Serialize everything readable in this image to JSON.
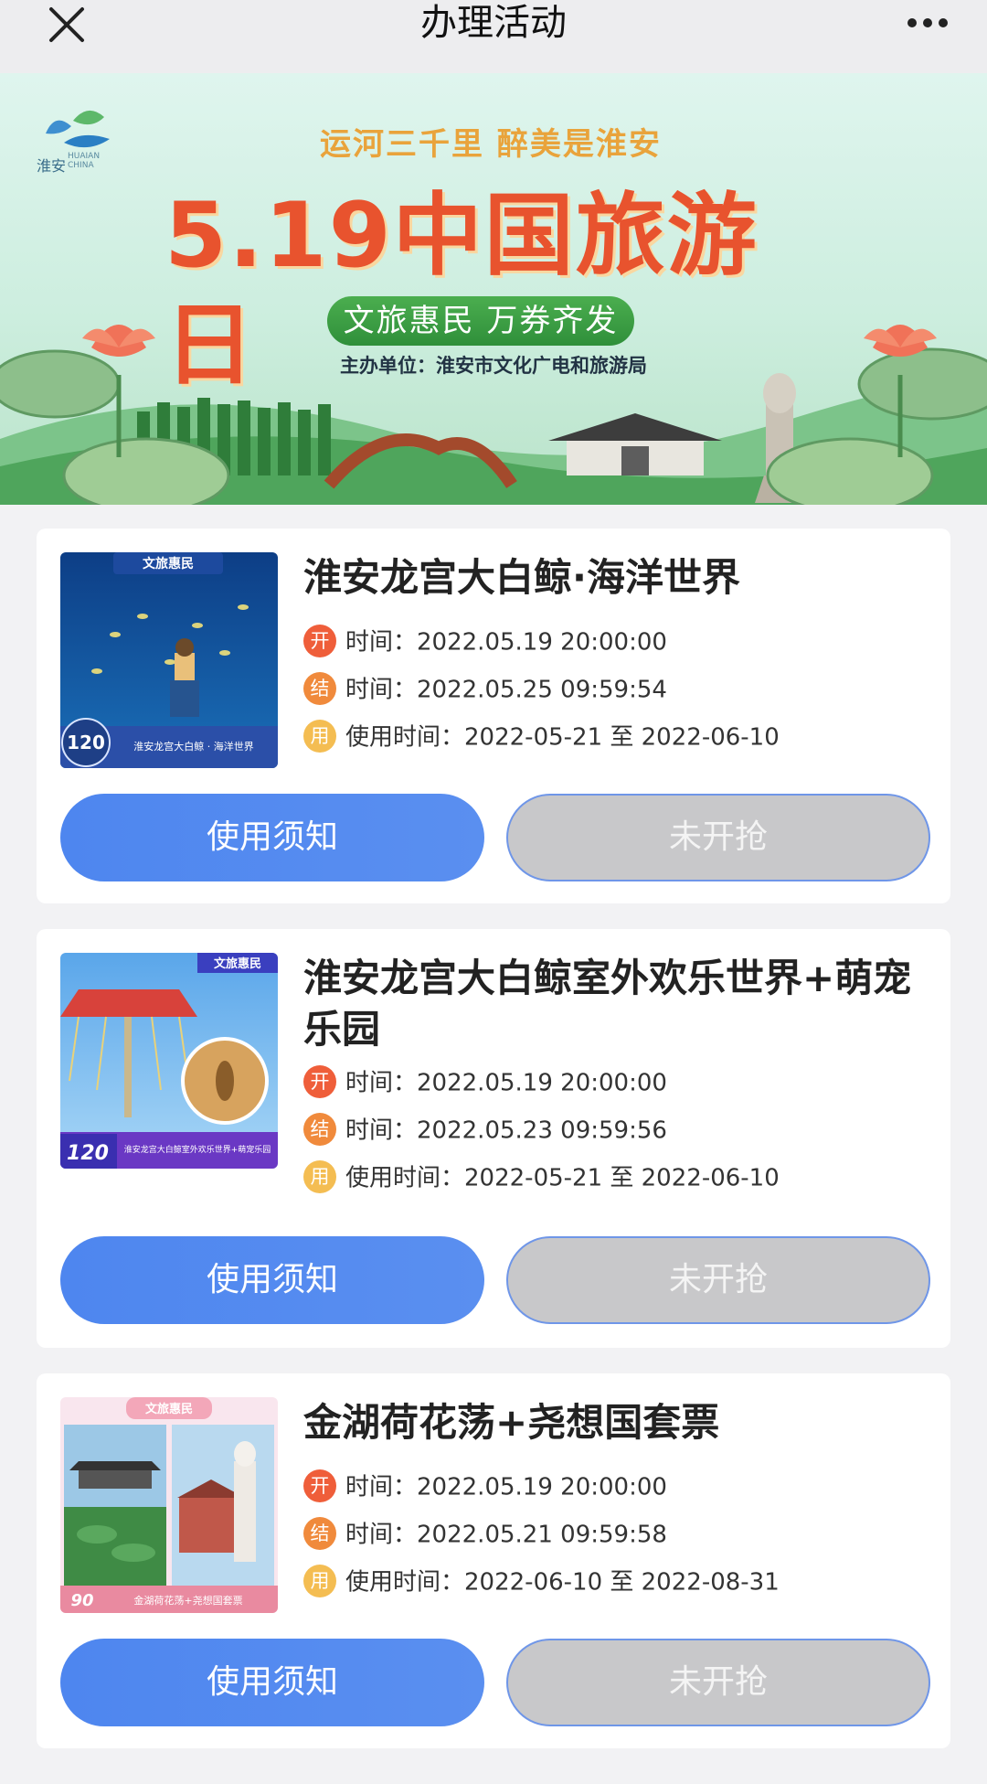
{
  "nav": {
    "title": "办理活动",
    "close_icon": "close-icon",
    "more_icon": "more-icon"
  },
  "banner": {
    "logo_text": "淮安",
    "logo_sub_1": "HUAIAN",
    "logo_sub_2": "CHINA",
    "slogan": "运河三千里 醉美是淮安",
    "headline": "5.19中国旅游日",
    "pill": "文旅惠民 万券齐发",
    "organizer": "主办单位：淮安市文化广电和旅游局"
  },
  "cards": [
    {
      "title": "淮安龙宫大白鲸·海洋世界",
      "open_label": "开",
      "open_text": "时间：",
      "open_time": "2022.05.19 20:00:00",
      "end_label": "结",
      "end_text": "时间：",
      "end_time": "2022.05.25 09:59:54",
      "use_label": "用",
      "use_text": "使用时间：",
      "use_time": "2022-05-21 至 2022-06-10",
      "thumb_tag": "文旅惠民",
      "thumb_price": "120",
      "thumb_caption": "淮安龙宫大白鲸 · 海洋世界",
      "notice_button": "使用须知",
      "grab_button": "未开抢"
    },
    {
      "title": "淮安龙宫大白鲸室外欢乐世界+萌宠乐园",
      "open_label": "开",
      "open_text": "时间：",
      "open_time": "2022.05.19 20:00:00",
      "end_label": "结",
      "end_text": "时间：",
      "end_time": "2022.05.23 09:59:56",
      "use_label": "用",
      "use_text": "使用时间：",
      "use_time": "2022-05-21 至 2022-06-10",
      "thumb_tag": "文旅惠民",
      "thumb_price": "120",
      "thumb_caption": "淮安龙宫大白鲸室外欢乐世界+萌宠乐园",
      "notice_button": "使用须知",
      "grab_button": "未开抢"
    },
    {
      "title": "金湖荷花荡+尧想国套票",
      "open_label": "开",
      "open_text": "时间：",
      "open_time": "2022.05.19 20:00:00",
      "end_label": "结",
      "end_text": "时间：",
      "end_time": "2022.05.21 09:59:58",
      "use_label": "用",
      "use_text": "使用时间：",
      "use_time": "2022-06-10 至 2022-08-31",
      "thumb_tag": "文旅惠民",
      "thumb_price": "90",
      "thumb_caption": "金湖荷花荡+尧想国套票",
      "notice_button": "使用须知",
      "grab_button": "未开抢"
    }
  ]
}
